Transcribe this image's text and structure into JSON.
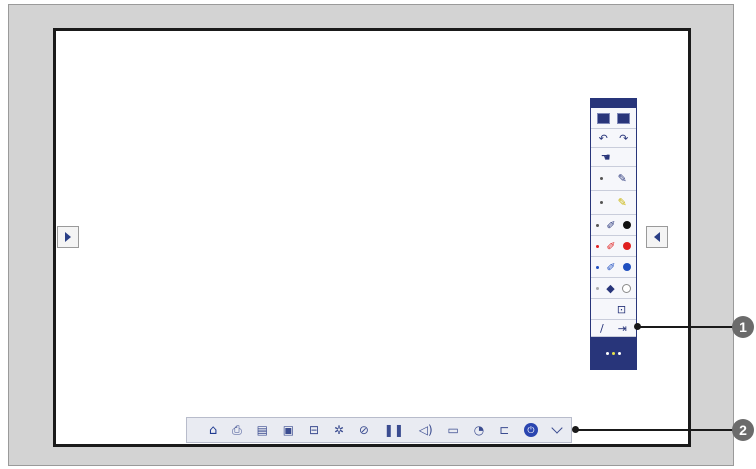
{
  "side_buttons": {
    "left_icon": "triangle-right-icon",
    "right_icon": "triangle-left-icon"
  },
  "pen_toolbar": {
    "rows": [
      {
        "name": "display-mode",
        "icons": [
          "whiteboard-mode-icon",
          "annotation-mode-icon"
        ]
      },
      {
        "name": "undo-redo",
        "icons": [
          "undo-icon",
          "redo-icon"
        ]
      },
      {
        "name": "pointer",
        "icons": [
          "pointer-icon"
        ]
      },
      {
        "name": "pen",
        "icons": [
          "pen-icon"
        ]
      },
      {
        "name": "highlighter",
        "icons": [
          "highlighter-icon"
        ]
      },
      {
        "name": "pen-black",
        "color": "#111111"
      },
      {
        "name": "pen-red",
        "color": "#e02020"
      },
      {
        "name": "pen-blue",
        "color": "#1f4fc0"
      },
      {
        "name": "eraser",
        "icons": [
          "eraser-icon",
          "circle-shape-icon"
        ]
      },
      {
        "name": "clear",
        "icons": [
          "clear-screen-icon"
        ]
      },
      {
        "name": "pen-width",
        "icons": [
          "pen-width-icon",
          "arrow-collapse-icon"
        ]
      }
    ],
    "accent": "#28357a"
  },
  "bottom_toolbar": {
    "icons": [
      "home-icon",
      "print-icon",
      "save-icon",
      "camera-icon",
      "source-icon",
      "brightness-icon",
      "freeze-icon",
      "pause-icon",
      "volume-icon",
      "aspect-icon",
      "timer-icon",
      "settings-icon",
      "power-icon",
      "chevron-down-icon"
    ]
  },
  "callouts": {
    "one": "1",
    "two": "2"
  }
}
